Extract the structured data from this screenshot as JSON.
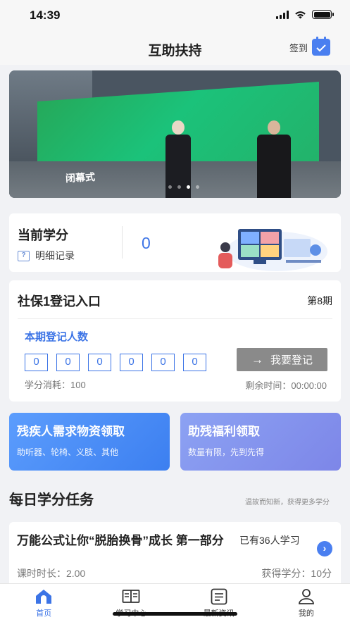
{
  "status": {
    "time": "14:39"
  },
  "header": {
    "title": "互助扶持",
    "checkin_label": "签到"
  },
  "banner": {
    "text": "闭幕式",
    "slides": 4,
    "active_slide": 3
  },
  "credits": {
    "title": "当前学分",
    "detail_label": "明细记录",
    "value": "0"
  },
  "social_security": {
    "title": "社保1登记入口",
    "period": "第8期",
    "count_label": "本期登记人数",
    "count_digits": [
      "0",
      "0",
      "0",
      "0",
      "0",
      "0"
    ],
    "register_label": "我要登记",
    "cost_text": "学分消耗：100",
    "remain_text": "剩余时间：00:00:00"
  },
  "promos": [
    {
      "title": "残疾人需求物资领取",
      "subtitle": "助听器、轮椅、义肢、其他"
    },
    {
      "title": "助残福利领取",
      "subtitle": "数量有限，先到先得"
    }
  ],
  "daily": {
    "title": "每日学分任务",
    "hint": "温故而知新，获得更多学分"
  },
  "task": {
    "title": "万能公式让你“脱胎换骨”成长 第一部分",
    "learners": "已有36人学习",
    "duration": "课时时长：2.00",
    "credits": "获得学分：10分"
  },
  "tabs": [
    {
      "label": "首页",
      "icon": "home-icon",
      "active": true
    },
    {
      "label": "学习中心",
      "icon": "book-icon",
      "active": false
    },
    {
      "label": "最新资讯",
      "icon": "news-icon",
      "active": false
    },
    {
      "label": "我的",
      "icon": "profile-icon",
      "active": false
    }
  ],
  "colors": {
    "accent": "#3c74e6",
    "promo_blue": "#4a8af7",
    "promo_purple": "#8592ec"
  }
}
